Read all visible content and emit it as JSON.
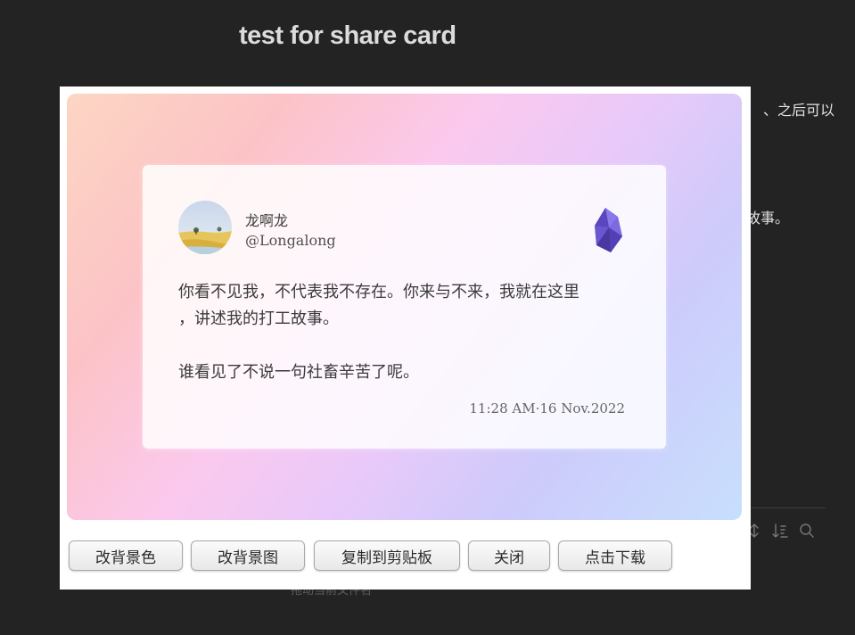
{
  "page": {
    "title": "test for share card",
    "background_text_1": "、之后可以",
    "background_text_2": "故事。",
    "footer_text": "拖动当前文件名"
  },
  "share_card": {
    "user": {
      "name": "龙啊龙",
      "handle": "@Longalong"
    },
    "content_lines": [
      "你看不见我，不代表我不存在。你来与不来，我就在这里",
      "，讲述我的打工故事。",
      "谁看见了不说一句社畜辛苦了呢。"
    ],
    "timestamp": "11:28 AM·16 Nov.2022",
    "logo_icon": "obsidian-icon",
    "gradient_colors": [
      "#fdd6c3",
      "#fcc3c6",
      "#fbc9ee",
      "#e9c9f9",
      "#cdcbfb",
      "#c8dffd"
    ]
  },
  "buttons": {
    "change_bg_color": "改背景色",
    "change_bg_image": "改背景图",
    "copy_to_clipboard": "复制到剪贴板",
    "close": "关闭",
    "download": "点击下载"
  },
  "toolbar_icons": [
    "sort-vertical-icon",
    "sort-order-icon",
    "search-icon"
  ]
}
